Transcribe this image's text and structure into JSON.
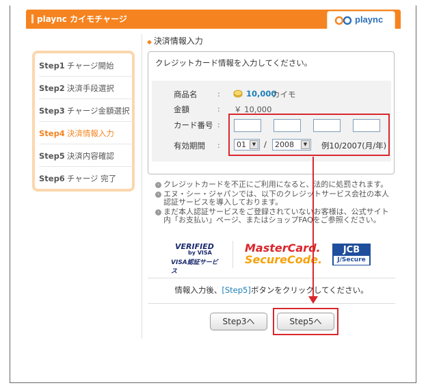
{
  "header": {
    "title": "plaync カイモチャージ",
    "logo_text": "plaync"
  },
  "steps": [
    {
      "num": "Step1",
      "label": "チャージ開始"
    },
    {
      "num": "Step2",
      "label": "決済手段選択"
    },
    {
      "num": "Step3",
      "label": "チャージ金額選択"
    },
    {
      "num": "Step4",
      "label": "決済情報入力"
    },
    {
      "num": "Step5",
      "label": "決済内容確認"
    },
    {
      "num": "Step6",
      "label": "チャージ 完了"
    }
  ],
  "active_step_index": 3,
  "section_title": "決済情報入力",
  "panel": {
    "note": "クレジットカード情報を入力してください。",
    "product_label": "商品名",
    "product_value": "10,000",
    "product_unit": "カイモ",
    "amount_label": "金額",
    "amount_value": "￥ 10,000",
    "card_label": "カード番号",
    "expiry_label": "有効期間",
    "colon": ":",
    "month_value": "01",
    "slash": "/",
    "year_value": "2008",
    "example": "例10/2007(月/年)"
  },
  "notes": [
    "クレジットカードを不正にご利用になると、法的に処罰されます。",
    "エヌ・シー・ジャパンでは、以下のクレジットサービス会社の本人認証サービスを導入しております。",
    "まだ本人認証サービスをご登録されていないお客様は、公式サイト内「お支払い」ページ、またはショップFAQをご参照ください。"
  ],
  "logos": {
    "visa_line1": "VERIFIED",
    "visa_line2": "by VISA",
    "visa_line3": "VISA認証サービス",
    "mc_line1": "MasterCard.",
    "mc_line2": "SecureCode.",
    "jcb_line1": "JCB",
    "jcb_line2": "J/Secure"
  },
  "info": {
    "prefix": "情報入力後、",
    "link": "[Step5]",
    "suffix": "ボタンをクリックしてください。"
  },
  "buttons": {
    "back": "Step3へ",
    "next": "Step5へ"
  },
  "colors": {
    "accent": "#f5831f",
    "annotation_red": "#d9262c",
    "link_blue": "#1c7fb8"
  }
}
